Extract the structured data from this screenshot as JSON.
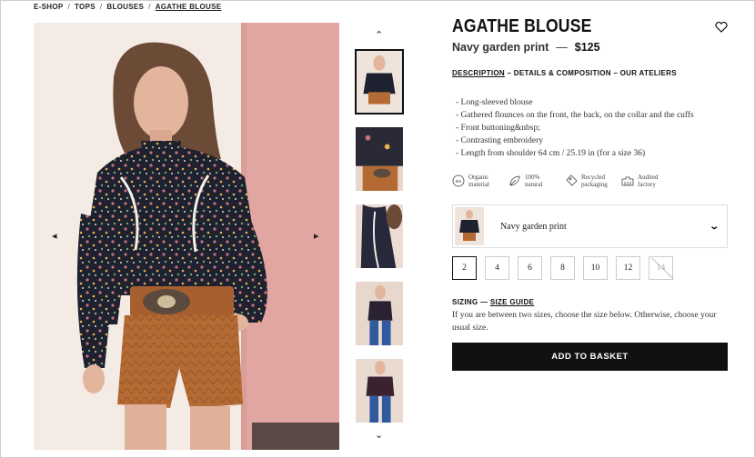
{
  "breadcrumb": {
    "items": [
      "E-SHOP",
      "TOPS",
      "BLOUSES",
      "AGATHE BLOUSE"
    ],
    "separator": "/"
  },
  "product": {
    "title": "AGATHE BLOUSE",
    "color_name": "Navy garden print",
    "dash": "—",
    "price": "$125"
  },
  "description_tabs": {
    "active": "DESCRIPTION",
    "sep1": " – ",
    "details": "DETAILS & COMPOSITION",
    "sep2": " – ",
    "ateliers": "OUR ATELIERS"
  },
  "features": [
    "- Long-sleeved blouse",
    "- Gathered flounces on the front, the back, on the collar and the cuffs",
    "- Front buttoning&nbsp;",
    "- Contrasting embroidery",
    "- Length from shoulder 64 cm / 25.19 in (for a size 36)"
  ],
  "badges": [
    {
      "icon": "bio-icon",
      "line1": "Organic",
      "line2": "material"
    },
    {
      "icon": "leaf-icon",
      "line1": "100%",
      "line2": "natural"
    },
    {
      "icon": "recycle-tag-icon",
      "line1": "Recycled",
      "line2": "packaging"
    },
    {
      "icon": "factory-icon",
      "line1": "Audited",
      "line2": "factory"
    }
  ],
  "color_select": {
    "selected": "Navy garden print"
  },
  "sizes": {
    "options": [
      "2",
      "4",
      "6",
      "8",
      "10",
      "12",
      "14"
    ],
    "selected": "2",
    "unavailable": [
      "14"
    ]
  },
  "size_guide": {
    "title": "SIZING",
    "dash": " — ",
    "link": "SIZE GUIDE",
    "text": "If you are between two sizes, choose the size below. Otherwise, choose your usual size."
  },
  "cta": {
    "add_to_basket": "ADD TO BASKET"
  },
  "gallery": {
    "thumbnail_count": 5,
    "active_thumbnail": 1
  },
  "colors": {
    "button_bg": "#111111",
    "button_text": "#ffffff",
    "border": "#dddddd"
  }
}
